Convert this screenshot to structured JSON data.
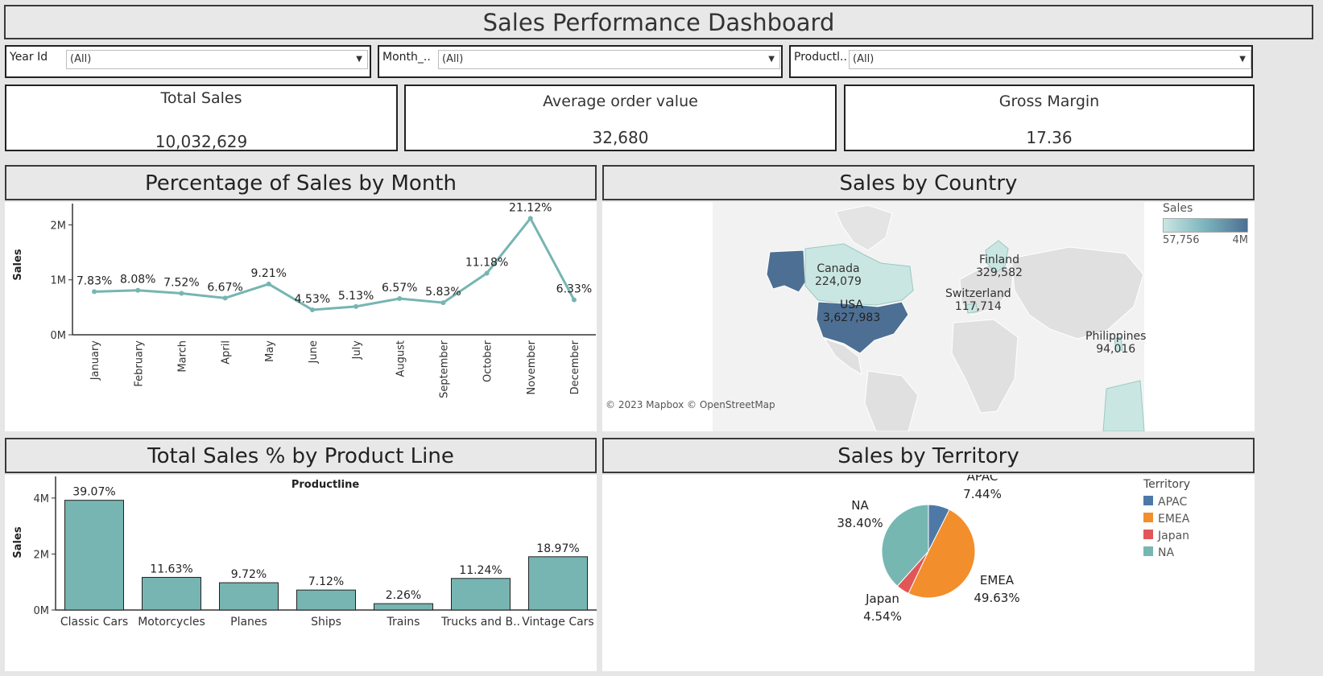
{
  "dashboard": {
    "title": "Sales Performance Dashboard"
  },
  "filters": [
    {
      "label": "Year Id",
      "value": "(All)"
    },
    {
      "label": "Month_..",
      "value": "(All)"
    },
    {
      "label": "Productl..",
      "value": "(All)"
    }
  ],
  "kpis": [
    {
      "label": "Total Sales",
      "value": "10,032,629"
    },
    {
      "label": "Average order value",
      "value": "32,680"
    },
    {
      "label": "Gross Margin",
      "value": "17.36"
    }
  ],
  "colors": {
    "teal": "#76b5b2",
    "map_dark": "#4d6f93",
    "map_light": "#c9e6e2",
    "apac": "#4e79a7",
    "emea": "#f28e2b",
    "japan": "#e15759",
    "na": "#76b7b2"
  },
  "month_chart": {
    "header": "Percentage of Sales by Month",
    "chart_data": {
      "type": "line",
      "title": "",
      "ylabel": "Sales",
      "ylim": [
        0,
        2300000
      ],
      "yticks": [
        {
          "v": 0,
          "label": "0M"
        },
        {
          "v": 1000000,
          "label": "1M"
        },
        {
          "v": 2000000,
          "label": "2M"
        }
      ],
      "categories": [
        "January",
        "February",
        "March",
        "April",
        "May",
        "June",
        "July",
        "August",
        "September",
        "October",
        "November",
        "December"
      ],
      "values": [
        785000,
        810000,
        754000,
        669000,
        924000,
        454000,
        515000,
        659000,
        585000,
        1121000,
        2119000,
        635000
      ],
      "labels": [
        "7.83%",
        "8.08%",
        "7.52%",
        "6.67%",
        "9.21%",
        "4.53%",
        "5.13%",
        "6.57%",
        "5.83%",
        "11.18%",
        "21.12%",
        "6.33%"
      ]
    }
  },
  "map": {
    "header": "Sales by Country",
    "legend_title": "Sales",
    "legend_min": "57,756",
    "legend_max": "4M",
    "attribution": "© 2023 Mapbox © OpenStreetMap",
    "countries": [
      {
        "name": "Canada",
        "value": "224,079"
      },
      {
        "name": "USA",
        "value": "3,627,983"
      },
      {
        "name": "Finland",
        "value": "329,582"
      },
      {
        "name": "Switzerland",
        "value": "117,714"
      },
      {
        "name": "Philippines",
        "value": "94,016"
      }
    ]
  },
  "product_chart": {
    "header": "Total Sales % by Product Line",
    "chart_data": {
      "type": "bar",
      "title": "Productline",
      "ylabel": "Sales",
      "ylim": [
        0,
        4600000
      ],
      "yticks": [
        {
          "v": 0,
          "label": "0M"
        },
        {
          "v": 2000000,
          "label": "2M"
        },
        {
          "v": 4000000,
          "label": "4M"
        }
      ],
      "categories": [
        "Classic Cars",
        "Motorcycles",
        "Planes",
        "Ships",
        "Trains",
        "Trucks and B..",
        "Vintage Cars"
      ],
      "values": [
        3920000,
        1166000,
        975000,
        714000,
        227000,
        1128000,
        1903000
      ],
      "labels": [
        "39.07%",
        "11.63%",
        "9.72%",
        "7.12%",
        "2.26%",
        "11.24%",
        "18.97%"
      ]
    }
  },
  "territory_chart": {
    "header": "Sales by Territory",
    "legend_title": "Territory",
    "chart_data": {
      "type": "pie",
      "title": "",
      "slices": [
        {
          "name": "APAC",
          "value": 7.44,
          "label": "7.44%",
          "color": "#4e79a7"
        },
        {
          "name": "EMEA",
          "value": 49.63,
          "label": "49.63%",
          "color": "#f28e2b"
        },
        {
          "name": "Japan",
          "value": 4.54,
          "label": "4.54%",
          "color": "#e15759"
        },
        {
          "name": "NA",
          "value": 38.4,
          "label": "38.40%",
          "color": "#76b7b2"
        }
      ]
    }
  }
}
